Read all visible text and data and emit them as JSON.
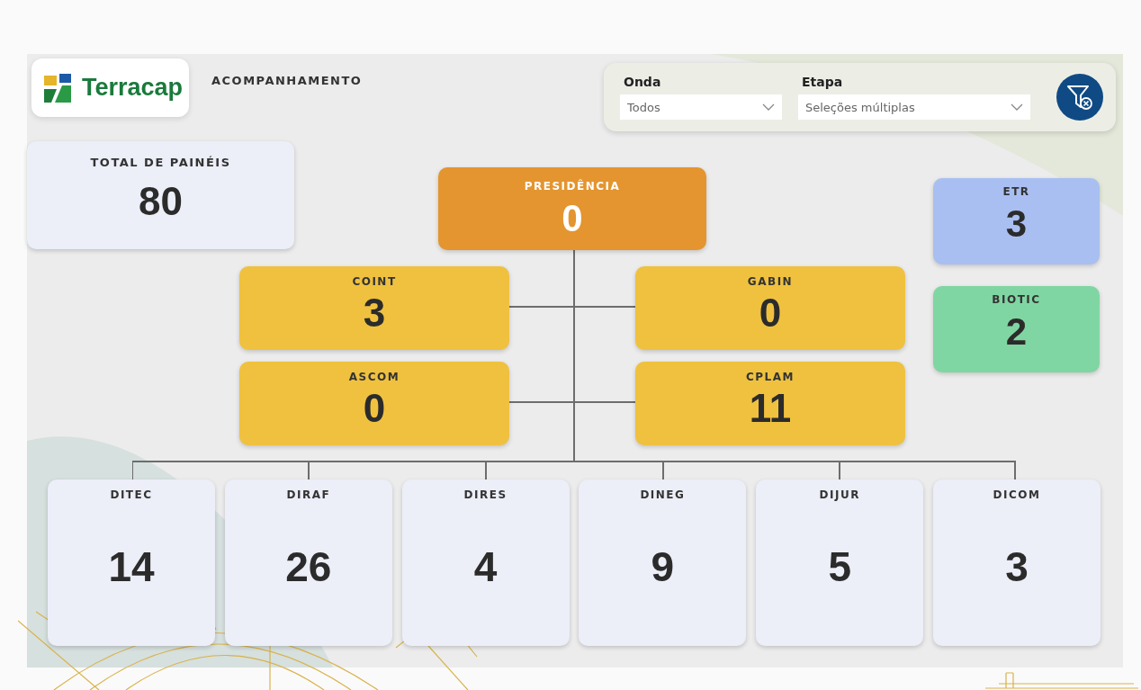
{
  "header": {
    "logo_text": "Terracap",
    "title": "ACOMPANHAMENTO"
  },
  "filters": [
    {
      "label": "Onda",
      "value": "Todos"
    },
    {
      "label": "Etapa",
      "value": "Seleções múltiplas"
    }
  ],
  "total": {
    "label": "TOTAL DE PAINÉIS",
    "value": "80"
  },
  "presidencia": {
    "label": "PRESIDÊNCIA",
    "value": "0"
  },
  "assessorias": [
    {
      "label": "COINT",
      "value": "3"
    },
    {
      "label": "GABIN",
      "value": "0"
    },
    {
      "label": "ASCOM",
      "value": "0"
    },
    {
      "label": "CPLAM",
      "value": "11"
    }
  ],
  "units": [
    {
      "label": "ETR",
      "value": "3",
      "color": "#a9bff2"
    },
    {
      "label": "BIOTIC",
      "value": "2",
      "color": "#80d6a2"
    }
  ],
  "diretorias": [
    {
      "label": "DITEC",
      "value": "14"
    },
    {
      "label": "DIRAF",
      "value": "26"
    },
    {
      "label": "DIRES",
      "value": "4"
    },
    {
      "label": "DINEG",
      "value": "9"
    },
    {
      "label": "DIJUR",
      "value": "5"
    },
    {
      "label": "DICOM",
      "value": "3"
    }
  ]
}
